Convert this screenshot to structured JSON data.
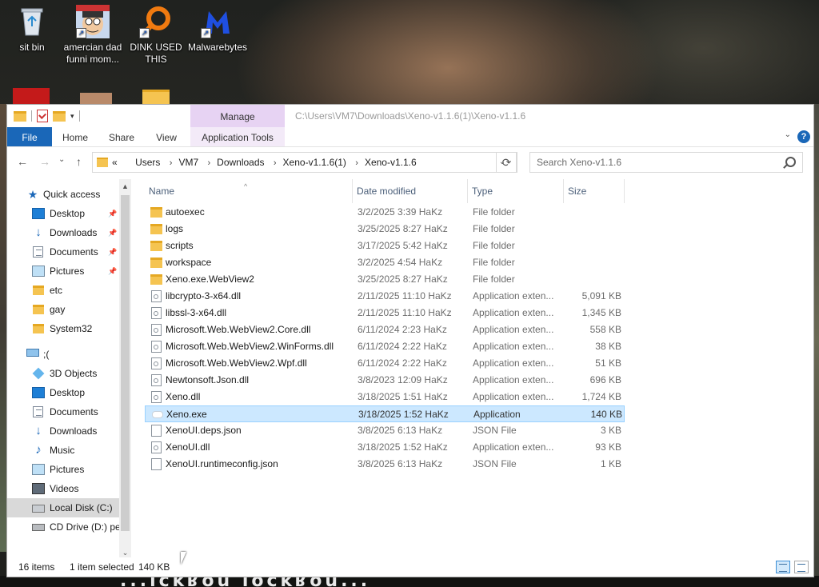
{
  "desktop": {
    "icons": [
      {
        "label": "sit bin",
        "icon": "recycle-bin-icon"
      },
      {
        "label": "amercian dad funni mom...",
        "icon": "cartoon-face-icon"
      },
      {
        "label": "DINK USED THIS",
        "icon": "orange-search-icon"
      },
      {
        "label": "Malwarebytes",
        "icon": "malwarebytes-icon"
      }
    ],
    "wallpaper_text": "...ıckʁou ıockʁou..."
  },
  "window": {
    "title_path": "C:\\Users\\VM7\\Downloads\\Xeno-v1.1.6(1)\\Xeno-v1.1.6",
    "contextual_tab": "Manage",
    "ribbon_tabs": [
      "File",
      "Home",
      "Share",
      "View",
      "Application Tools"
    ],
    "colors": {
      "file_tab": "#1a67b8",
      "manage_tab": "#e7d3f3",
      "selection": "#cce8ff"
    }
  },
  "navbar": {
    "back": "←",
    "forward": "→",
    "recent": "⌄",
    "up": "↑",
    "breadcrumb_overflow": "«",
    "breadcrumbs": [
      "Users",
      "VM7",
      "Downloads",
      "Xeno-v1.1.6(1)",
      "Xeno-v1.1.6"
    ],
    "search_placeholder": "Search Xeno-v1.1.6"
  },
  "navpane": {
    "items": [
      {
        "label": "Quick access",
        "icon": "star-icon"
      },
      {
        "label": "Desktop",
        "icon": "desktop-icon",
        "pinned": true
      },
      {
        "label": "Downloads",
        "icon": "download-icon",
        "pinned": true
      },
      {
        "label": "Documents",
        "icon": "documents-icon",
        "pinned": true
      },
      {
        "label": "Pictures",
        "icon": "pictures-icon",
        "pinned": true
      },
      {
        "label": "etc",
        "icon": "folder-icon"
      },
      {
        "label": "gay",
        "icon": "folder-icon"
      },
      {
        "label": "System32",
        "icon": "folder-icon"
      },
      {
        "label": ";(",
        "icon": "this-pc-icon"
      },
      {
        "label": "3D Objects",
        "icon": "3d-objects-icon"
      },
      {
        "label": "Desktop",
        "icon": "desktop-icon"
      },
      {
        "label": "Documents",
        "icon": "documents-icon"
      },
      {
        "label": "Downloads",
        "icon": "download-icon"
      },
      {
        "label": "Music",
        "icon": "music-icon"
      },
      {
        "label": "Pictures",
        "icon": "pictures-icon"
      },
      {
        "label": "Videos",
        "icon": "videos-icon"
      },
      {
        "label": "Local Disk (C:)",
        "icon": "local-disk-icon",
        "selected": true
      },
      {
        "label": "CD Drive (D:) per",
        "icon": "cd-drive-icon"
      }
    ]
  },
  "filelist": {
    "columns": [
      "Name",
      "Date modified",
      "Type",
      "Size"
    ],
    "rows": [
      {
        "name": "autoexec",
        "date": "3/2/2025 3:39 HaKz",
        "type": "File folder",
        "size": "",
        "kind": "folder"
      },
      {
        "name": "logs",
        "date": "3/25/2025 8:27 HaKz",
        "type": "File folder",
        "size": "",
        "kind": "folder"
      },
      {
        "name": "scripts",
        "date": "3/17/2025 5:42 HaKz",
        "type": "File folder",
        "size": "",
        "kind": "folder"
      },
      {
        "name": "workspace",
        "date": "3/2/2025 4:54 HaKz",
        "type": "File folder",
        "size": "",
        "kind": "folder"
      },
      {
        "name": "Xeno.exe.WebView2",
        "date": "3/25/2025 8:27 HaKz",
        "type": "File folder",
        "size": "",
        "kind": "folder"
      },
      {
        "name": "libcrypto-3-x64.dll",
        "date": "2/11/2025 11:10 HaKz",
        "type": "Application exten...",
        "size": "5,091 KB",
        "kind": "dll"
      },
      {
        "name": "libssl-3-x64.dll",
        "date": "2/11/2025 11:10 HaKz",
        "type": "Application exten...",
        "size": "1,345 KB",
        "kind": "dll"
      },
      {
        "name": "Microsoft.Web.WebView2.Core.dll",
        "date": "6/11/2024 2:23 HaKz",
        "type": "Application exten...",
        "size": "558 KB",
        "kind": "dll"
      },
      {
        "name": "Microsoft.Web.WebView2.WinForms.dll",
        "date": "6/11/2024 2:22 HaKz",
        "type": "Application exten...",
        "size": "38 KB",
        "kind": "dll"
      },
      {
        "name": "Microsoft.Web.WebView2.Wpf.dll",
        "date": "6/11/2024 2:22 HaKz",
        "type": "Application exten...",
        "size": "51 KB",
        "kind": "dll"
      },
      {
        "name": "Newtonsoft.Json.dll",
        "date": "3/8/2023 12:09 HaKz",
        "type": "Application exten...",
        "size": "696 KB",
        "kind": "dll"
      },
      {
        "name": "Xeno.dll",
        "date": "3/18/2025 1:51 HaKz",
        "type": "Application exten...",
        "size": "1,724 KB",
        "kind": "dll"
      },
      {
        "name": "Xeno.exe",
        "date": "3/18/2025 1:52 HaKz",
        "type": "Application",
        "size": "140 KB",
        "kind": "exe",
        "selected": true
      },
      {
        "name": "XenoUI.deps.json",
        "date": "3/8/2025 6:13 HaKz",
        "type": "JSON File",
        "size": "3 KB",
        "kind": "json"
      },
      {
        "name": "XenoUI.dll",
        "date": "3/18/2025 1:52 HaKz",
        "type": "Application exten...",
        "size": "93 KB",
        "kind": "dll"
      },
      {
        "name": "XenoUI.runtimeconfig.json",
        "date": "3/8/2025 6:13 HaKz",
        "type": "JSON File",
        "size": "1 KB",
        "kind": "json"
      }
    ]
  },
  "status": {
    "items": "16 items",
    "selected": "1 item selected",
    "size": "140 KB"
  }
}
